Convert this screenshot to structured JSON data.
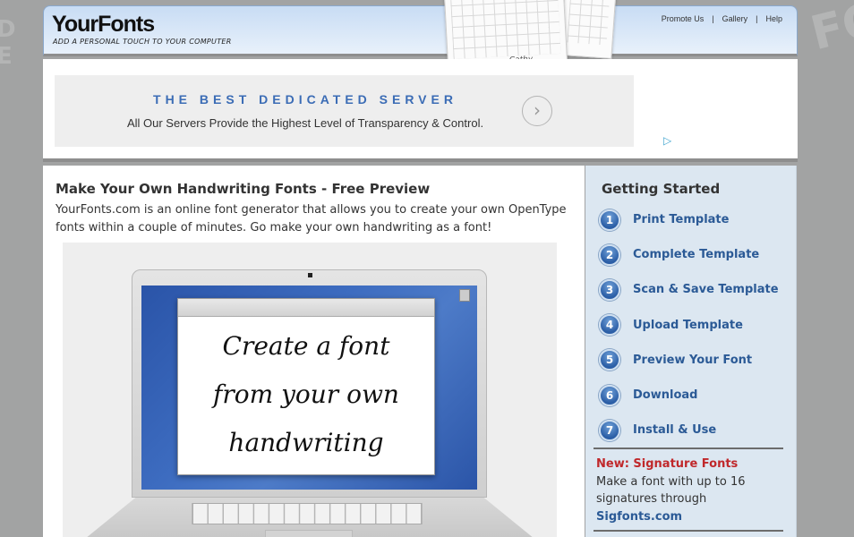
{
  "background": {
    "left_letters": "D\nE",
    "right_letters": "FO"
  },
  "header": {
    "logo": "YourFonts",
    "tagline": "ADD A PERSONAL TOUCH TO YOUR COMPUTER",
    "nav": [
      {
        "label": "Promote Us"
      },
      {
        "label": "Gallery"
      },
      {
        "label": "Help"
      }
    ],
    "nav_separator": "|",
    "template_signature": "Cathy"
  },
  "ad": {
    "title": "THE BEST DEDICATED SERVER",
    "description": "All Our Servers Provide the Highest Level of Transparency & Control.",
    "arrow_icon": "›",
    "adchoices_icon": "▷"
  },
  "main": {
    "title": "Make Your Own Handwriting Fonts - Free Preview",
    "intro": "YourFonts.com is an online font generator that allows you to create your own OpenType fonts within a couple of minutes. Go make your own handwriting as a font!",
    "hero_text": [
      "Create a font",
      "from your own",
      "handwriting"
    ]
  },
  "sidebar": {
    "title": "Getting Started",
    "steps": [
      {
        "number": "1",
        "label": "Print Template"
      },
      {
        "number": "2",
        "label": "Complete Template"
      },
      {
        "number": "3",
        "label": "Scan & Save Template"
      },
      {
        "number": "4",
        "label": "Upload Template"
      },
      {
        "number": "5",
        "label": "Preview Your Font"
      },
      {
        "number": "6",
        "label": "Download"
      },
      {
        "number": "7",
        "label": "Install & Use"
      }
    ],
    "promo": {
      "title": "New: Signature Fonts",
      "text": "Make a font with up to 16 signatures through",
      "link": "Sigfonts.com"
    }
  },
  "colors": {
    "background": "#a2a3a3",
    "link_blue": "#2b5a96",
    "ad_title_blue": "#3b6cb5",
    "promo_red": "#c0282b",
    "sidebar_bg": "#dce7f1"
  }
}
